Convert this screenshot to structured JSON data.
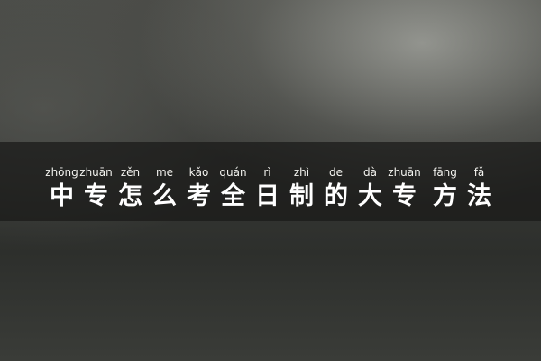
{
  "title": {
    "characters": [
      {
        "pinyin": "zhōng",
        "hanzi": "中"
      },
      {
        "pinyin": "zhuān",
        "hanzi": "专"
      },
      {
        "pinyin": "zěn",
        "hanzi": "怎"
      },
      {
        "pinyin": "me",
        "hanzi": "么"
      },
      {
        "pinyin": "kǎo",
        "hanzi": "考"
      },
      {
        "pinyin": "quán",
        "hanzi": "全"
      },
      {
        "pinyin": "rì",
        "hanzi": "日"
      },
      {
        "pinyin": "zhì",
        "hanzi": "制"
      },
      {
        "pinyin": "de",
        "hanzi": "的"
      },
      {
        "pinyin": "dà",
        "hanzi": "大"
      },
      {
        "pinyin": "zhuān",
        "hanzi": "专"
      },
      {
        "pinyin": "fāng",
        "hanzi": "方"
      },
      {
        "pinyin": "fǎ",
        "hanzi": "法"
      }
    ]
  }
}
